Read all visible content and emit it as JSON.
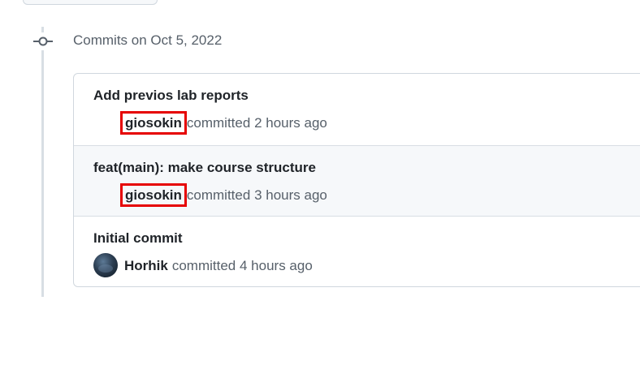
{
  "heading": "Commits on Oct 5, 2022",
  "commits": [
    {
      "title": "Add previos lab reports",
      "author": "giosokin",
      "action": "committed",
      "time": "2 hours ago",
      "highlighted": true,
      "has_avatar": false
    },
    {
      "title": "feat(main): make course structure",
      "author": "giosokin",
      "action": "committed",
      "time": "3 hours ago",
      "highlighted": true,
      "has_avatar": false
    },
    {
      "title": "Initial commit",
      "author": "Horhik",
      "action": "committed",
      "time": "4 hours ago",
      "highlighted": false,
      "has_avatar": true
    }
  ],
  "colors": {
    "highlight": "#e60000",
    "muted_text": "#57606a",
    "text": "#1f2328",
    "border": "#d0d7de",
    "row_alt_bg": "#f6f8fa"
  }
}
